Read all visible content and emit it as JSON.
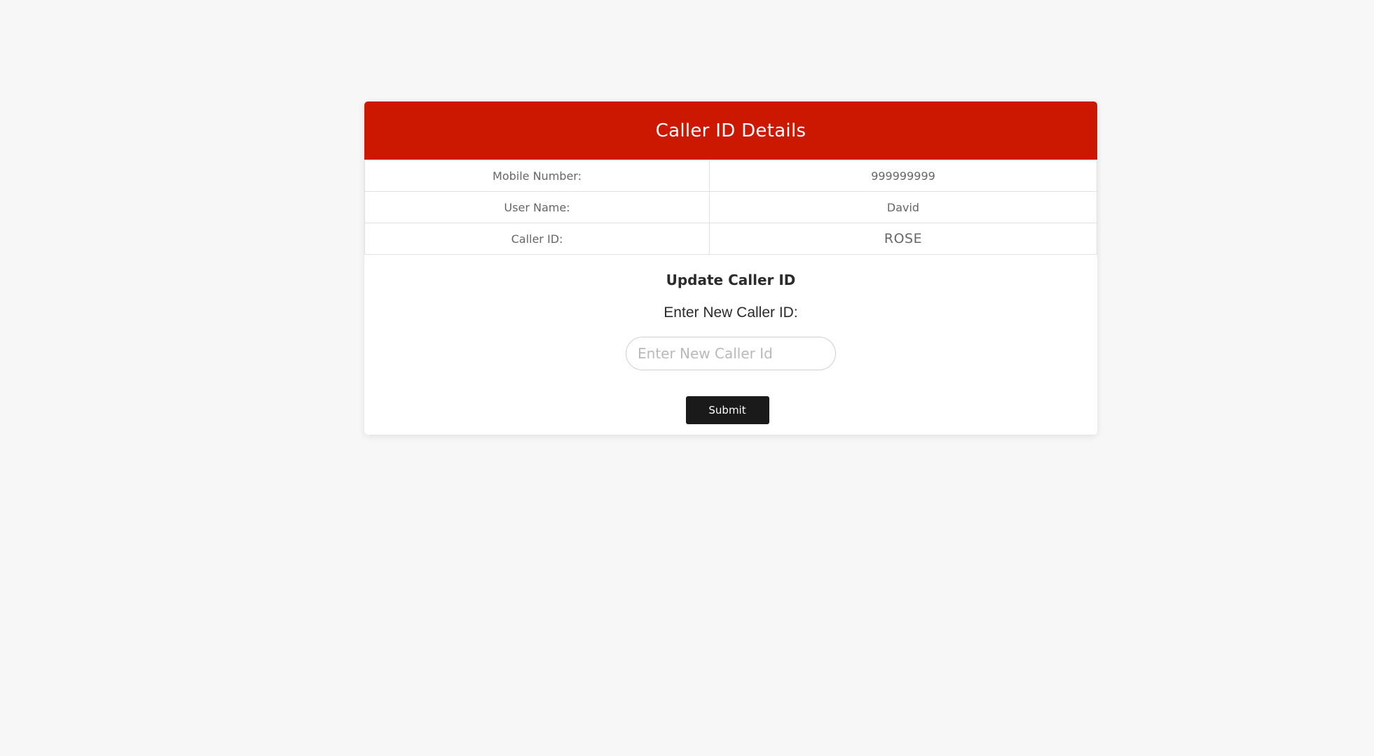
{
  "header": {
    "title": "Caller ID Details"
  },
  "details": [
    {
      "label": "Mobile Number:",
      "value": "999999999"
    },
    {
      "label": "User Name:",
      "value": "David"
    },
    {
      "label": "Caller ID:",
      "value": "ROSE"
    }
  ],
  "update": {
    "title": "Update Caller ID",
    "field_label": "Enter New Caller ID:",
    "input_value": "",
    "input_placeholder": "Enter New Caller Id",
    "submit_label": "Submit"
  },
  "colors": {
    "header_background": "#cc1800",
    "button_background": "#1a1a1a",
    "page_background": "#f7f7f7"
  }
}
